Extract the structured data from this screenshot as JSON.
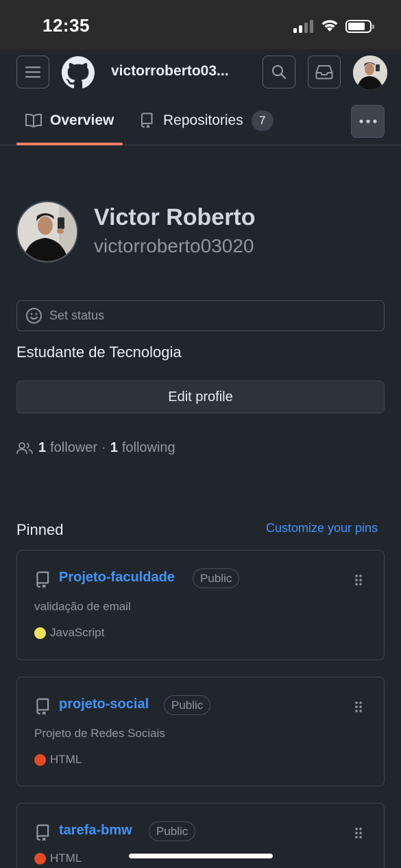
{
  "status_bar": {
    "time": "12:35"
  },
  "header": {
    "username": "victorroberto03..."
  },
  "tabs": [
    {
      "label": "Overview",
      "selected": true
    },
    {
      "label": "Repositories",
      "count": "7"
    }
  ],
  "profile": {
    "name": "Victor Roberto",
    "login": "victorroberto03020",
    "status_placeholder": "Set status",
    "bio": "Estudante de Tecnologia",
    "edit_label": "Edit profile",
    "followers_count": "1",
    "followers_label": "follower",
    "separator": "·",
    "following_count": "1",
    "following_label": "following"
  },
  "pinned": {
    "title": "Pinned",
    "customize_label": "Customize your pins",
    "repos": [
      {
        "name": "Projeto-faculdade",
        "visibility": "Public",
        "description": "validação de email",
        "language": "JavaScript",
        "lang_color": "#f1e05a"
      },
      {
        "name": "projeto-social",
        "visibility": "Public",
        "description": "Projeto de Redes Sociais",
        "language": "HTML",
        "lang_color": "#e34c26"
      },
      {
        "name": "tarefa-bmw",
        "visibility": "Public",
        "description": "",
        "language": "HTML",
        "lang_color": "#e34c26"
      }
    ]
  },
  "colors": {
    "background": "#21262d",
    "accent": "#f78166",
    "link": "#4493f8"
  }
}
